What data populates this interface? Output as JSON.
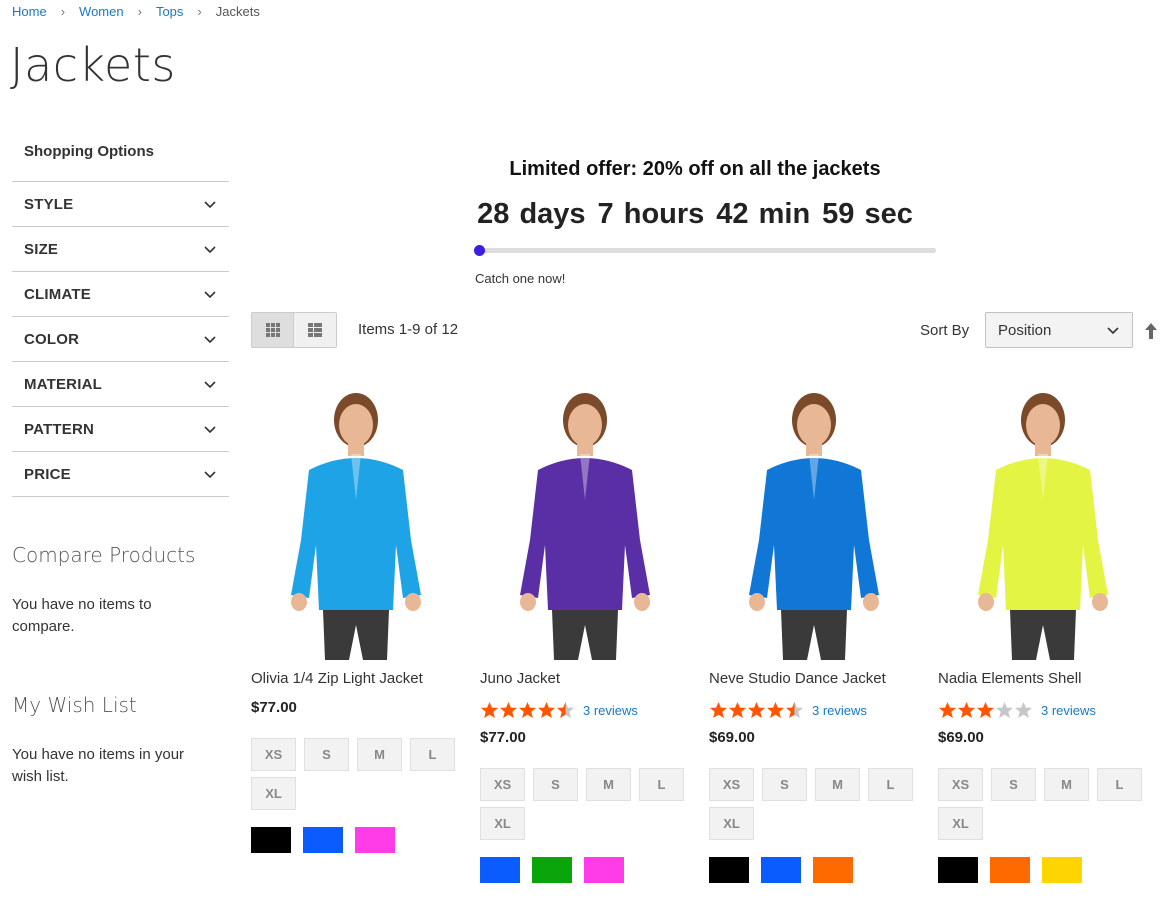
{
  "breadcrumb": {
    "home": "Home",
    "women": "Women",
    "tops": "Tops",
    "current": "Jackets"
  },
  "page_title": "Jackets",
  "sidebar": {
    "title": "Shopping Options",
    "filters": [
      "STYLE",
      "SIZE",
      "CLIMATE",
      "COLOR",
      "MATERIAL",
      "PATTERN",
      "PRICE"
    ],
    "compare_title": "Compare Products",
    "compare_text": "You have no items to compare.",
    "wish_title": "My Wish List",
    "wish_text": "You have no items in your wish list."
  },
  "promo": {
    "offer": "Limited offer: 20% off on all the jackets",
    "days": "28 days",
    "hours": "7 hours",
    "minutes": "42 min",
    "seconds": "59 sec",
    "progress_fraction": 0.01,
    "progress_color": "#3a1fe0",
    "cta": "Catch one now!"
  },
  "toolbar": {
    "items_count": "Items 1-9 of 12",
    "sort_label": "Sort By",
    "sort_value": "Position"
  },
  "products": [
    {
      "name": "Olivia 1/4 Zip Light Jacket",
      "rating": 0,
      "reviews": "",
      "price": "$77.00",
      "sizes": [
        "XS",
        "S",
        "M",
        "L",
        "XL"
      ],
      "colors": [
        "#000000",
        "#0b5cff",
        "#ff3ce8"
      ],
      "jacket_color": "#1ea3e6"
    },
    {
      "name": "Juno Jacket",
      "rating": 4.5,
      "reviews": "3 reviews",
      "price": "$77.00",
      "sizes": [
        "XS",
        "S",
        "M",
        "L",
        "XL"
      ],
      "colors": [
        "#0b5cff",
        "#0aa50a",
        "#ff3ce8"
      ],
      "jacket_color": "#5a2fa6"
    },
    {
      "name": "Neve Studio Dance Jacket",
      "rating": 4.5,
      "reviews": "3 reviews",
      "price": "$69.00",
      "sizes": [
        "XS",
        "S",
        "M",
        "L",
        "XL"
      ],
      "colors": [
        "#000000",
        "#0b5cff",
        "#ff6a00"
      ],
      "jacket_color": "#1177d6"
    },
    {
      "name": "Nadia Elements Shell",
      "rating": 3,
      "reviews": "3 reviews",
      "price": "$69.00",
      "sizes": [
        "XS",
        "S",
        "M",
        "L",
        "XL"
      ],
      "colors": [
        "#000000",
        "#ff6a00",
        "#ffd500"
      ],
      "jacket_color": "#e3f542"
    }
  ],
  "star_color": "#ff5501",
  "link_color": "#1979c3"
}
